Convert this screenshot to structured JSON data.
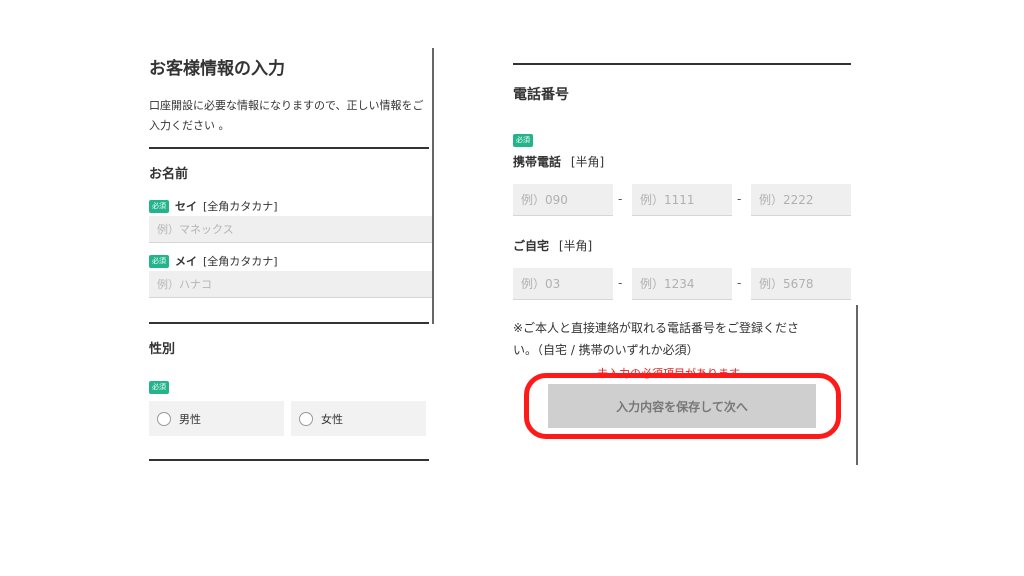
{
  "left": {
    "title": "お客様情報の入力",
    "description_line1": "口座開設に必要な情報になりますので、正しい情報をご",
    "description_line2": "入力ください 。",
    "name_section": {
      "title": "お名前",
      "required_badge": "必須",
      "sei_label": "セイ",
      "sei_hint": "[全角カタカナ]",
      "sei_placeholder": "例）マネックス",
      "mei_label": "メイ",
      "mei_hint": "[全角カタカナ]",
      "mei_placeholder": "例）ハナコ"
    },
    "gender_section": {
      "title": "性別",
      "required_badge": "必須",
      "option_male": "男性",
      "option_female": "女性"
    }
  },
  "right": {
    "phone_section": {
      "title": "電話番号",
      "required_badge": "必須",
      "mobile_label": "携帯電話",
      "mobile_hint": "[半角]",
      "mobile_placeholders": [
        "例）090",
        "例）1111",
        "例）2222"
      ],
      "home_label": "ご自宅",
      "home_hint": "[半角]",
      "home_placeholders": [
        "例）03",
        "例）1234",
        "例）5678"
      ],
      "dash": "-",
      "note_line1": "※ご本人と直接連絡が取れる電話番号をご登録くださ",
      "note_line2": "い。（自宅 / 携帯のいずれか必須）"
    },
    "error_text": "未入力の必須項目があります",
    "submit_label": "入力内容を保存して次へ"
  },
  "colors": {
    "badge": "#23b48c",
    "highlight": "#ff1a1a",
    "error": "#e02020"
  }
}
